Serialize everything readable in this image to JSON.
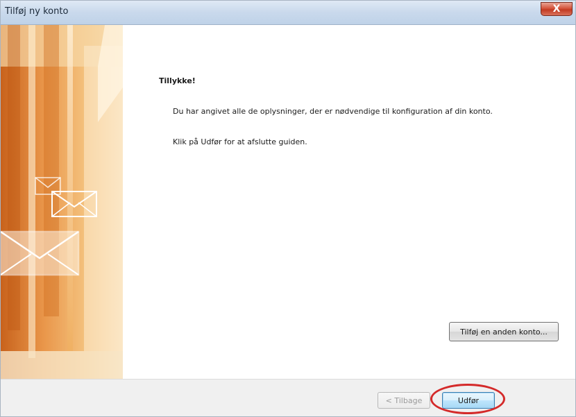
{
  "window": {
    "title": "Tilføj ny konto",
    "close_glyph": "X"
  },
  "main": {
    "heading": "Tillykke!",
    "line1": "Du har angivet alle de oplysninger, der er nødvendige til konfiguration af din konto.",
    "line2": "Klik på Udfør for at afslutte guiden.",
    "add_account_button": "Tilføj en anden konto..."
  },
  "footer": {
    "back_button": "< Tilbage",
    "finish_button": "Udfør"
  },
  "colors": {
    "highlight": "#d42a2a",
    "art_orange": "#e08a3a"
  },
  "icons": {
    "side_art": "envelope-art-icon",
    "close": "close-icon"
  }
}
